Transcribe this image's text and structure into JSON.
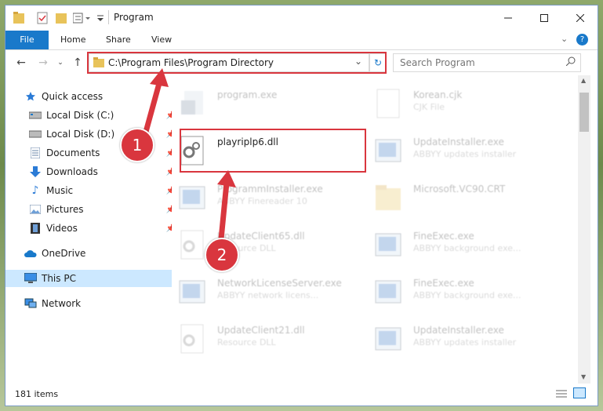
{
  "window": {
    "title": "Program"
  },
  "ribbon": {
    "tabs": [
      "File",
      "Home",
      "Share",
      "View"
    ]
  },
  "address": {
    "path": "C:\\Program Files\\Program Directory"
  },
  "search": {
    "placeholder": "Search Program"
  },
  "nav": {
    "quick_access": "Quick access",
    "items": [
      "Local Disk (C:)",
      "Local Disk (D:)",
      "Documents",
      "Downloads",
      "Music",
      "Pictures",
      "Videos"
    ],
    "onedrive": "OneDrive",
    "this_pc": "This PC",
    "network": "Network"
  },
  "files": [
    {
      "name": "program.exe",
      "desc": ""
    },
    {
      "name": "Korean.cjk",
      "desc": "CJK File"
    },
    {
      "name": "playriplp6.dll",
      "desc": ""
    },
    {
      "name": "UpdateInstaller.exe",
      "desc": "ABBYY updates installer"
    },
    {
      "name": "ProgrammInstaller.exe",
      "desc": "ABBYY Finereader 10"
    },
    {
      "name": "Microsoft.VC90.CRT",
      "desc": ""
    },
    {
      "name": "UpdateClient65.dll",
      "desc": "Resource DLL"
    },
    {
      "name": "FineExec.exe",
      "desc": "ABBYY background exe..."
    },
    {
      "name": "NetworkLicenseServer.exe",
      "desc": "ABBYY network licens..."
    },
    {
      "name": "FineExec.exe",
      "desc": "ABBYY background exe..."
    },
    {
      "name": "UpdateClient21.dll",
      "desc": "Resource DLL"
    },
    {
      "name": "UpdateInstaller.exe",
      "desc": "ABBYY updates installer"
    }
  ],
  "status": {
    "items": "181 items"
  },
  "annotations": {
    "step1": "1",
    "step2": "2"
  },
  "colors": {
    "accent": "#1979ca",
    "highlight": "#d9363e"
  }
}
